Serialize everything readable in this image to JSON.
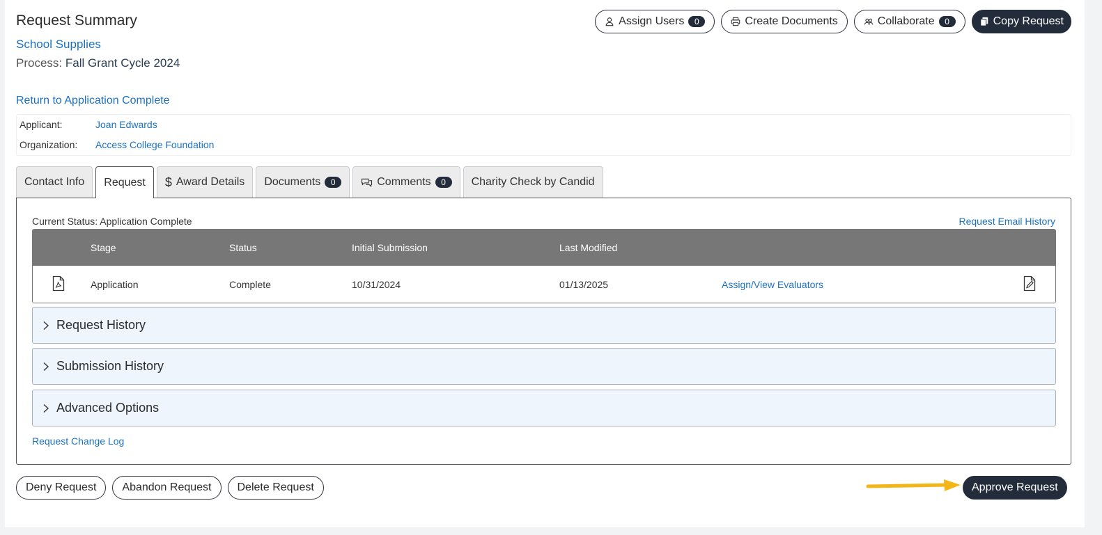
{
  "header": {
    "title": "Request Summary",
    "request_name": "School Supplies",
    "process_label": "Process:",
    "process_value": "Fall Grant Cycle 2024",
    "return_link": "Return to Application Complete"
  },
  "top_actions": {
    "assign_users": "Assign Users",
    "assign_users_count": "0",
    "create_documents": "Create Documents",
    "collaborate": "Collaborate",
    "collaborate_count": "0",
    "copy_request": "Copy Request"
  },
  "info": {
    "applicant_label": "Applicant:",
    "applicant_value": "Joan Edwards",
    "organization_label": "Organization:",
    "organization_value": "Access College Foundation"
  },
  "tabs": {
    "contact_info": "Contact Info",
    "request": "Request",
    "award_details": "Award Details",
    "documents": "Documents",
    "documents_count": "0",
    "comments": "Comments",
    "comments_count": "0",
    "charity_check": "Charity Check by Candid"
  },
  "panel": {
    "current_status": "Current Status: Application Complete",
    "email_history": "Request Email History",
    "table": {
      "headers": {
        "stage": "Stage",
        "status": "Status",
        "initial_submission": "Initial Submission",
        "last_modified": "Last Modified"
      },
      "row": {
        "stage": "Application",
        "status": "Complete",
        "initial_submission": "10/31/2024",
        "last_modified": "01/13/2025",
        "evaluators_link": "Assign/View Evaluators"
      }
    },
    "accordions": {
      "request_history": "Request History",
      "submission_history": "Submission History",
      "advanced_options": "Advanced Options"
    },
    "change_log": "Request Change Log"
  },
  "bottom_actions": {
    "deny": "Deny Request",
    "abandon": "Abandon Request",
    "delete": "Delete Request",
    "approve": "Approve Request"
  },
  "colors": {
    "accent_link": "#1b72c4",
    "dark_button": "#232c3b",
    "annotation_arrow": "#f2b618"
  }
}
